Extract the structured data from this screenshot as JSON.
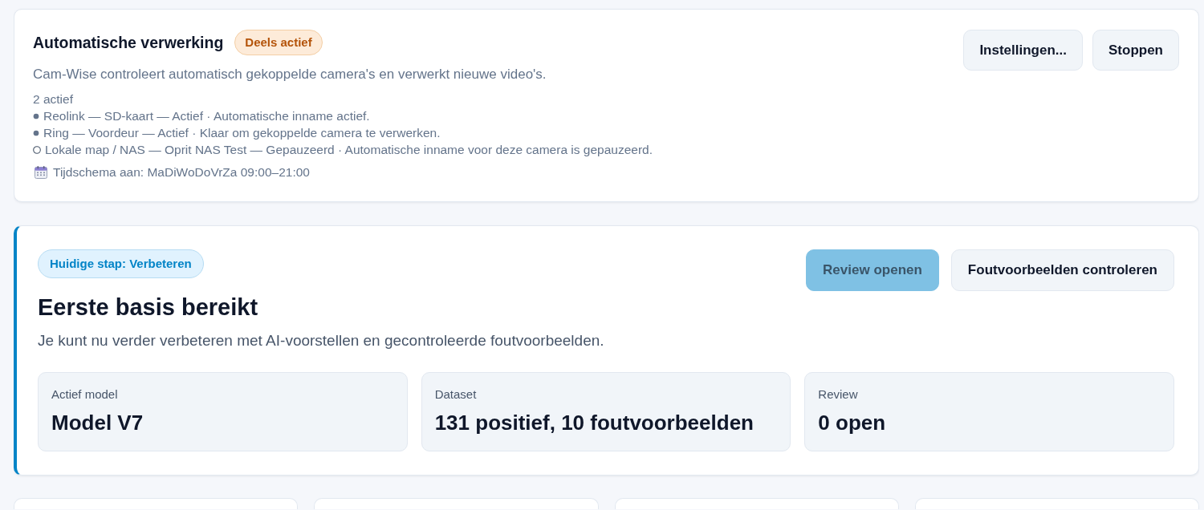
{
  "automation": {
    "title": "Automatische verwerking",
    "badge": "Deels actief",
    "description": "Cam-Wise controleert automatisch gekoppelde camera's en verwerkt nieuwe video's.",
    "active_count": "2 actief",
    "cameras": [
      {
        "text": "Reolink — SD-kaart — Actief · Automatische inname actief.",
        "active": true
      },
      {
        "text": "Ring — Voordeur — Actief · Klaar om gekoppelde camera te verwerken.",
        "active": true
      },
      {
        "text": "Lokale map / NAS — Oprit NAS Test — Gepauzeerd · Automatische inname voor deze camera is gepauzeerd.",
        "active": false
      }
    ],
    "schedule": "Tijdschema aan: MaDiWoDoVrZa 09:00–21:00",
    "buttons": [
      "Instellingen...",
      "Stoppen"
    ]
  },
  "progress": {
    "step_badge": "Huidige stap: Verbeteren",
    "heading": "Eerste basis bereikt",
    "description": "Je kunt nu verder verbeteren met AI-voorstellen en gecontroleerde foutvoorbeelden.",
    "buttons": [
      {
        "label": "Review openen",
        "kind": "primary",
        "disabled": true
      },
      {
        "label": "Foutvoorbeelden controleren",
        "kind": "secondary",
        "disabled": false
      }
    ],
    "stats": [
      {
        "label": "Actief model",
        "value": "Model V7"
      },
      {
        "label": "Dataset",
        "value": "131 positief, 10 foutvoorbeelden"
      },
      {
        "label": "Review",
        "value": "0 open"
      }
    ]
  }
}
